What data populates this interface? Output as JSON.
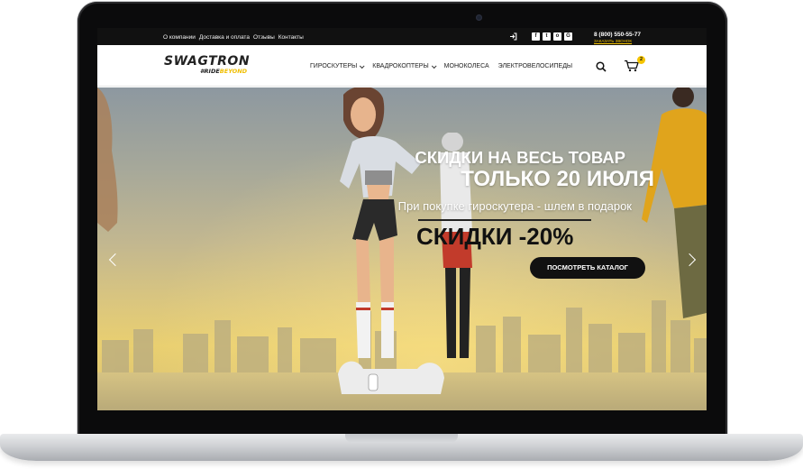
{
  "topbar": {
    "links": [
      "О компании",
      "Доставка и оплата",
      "Отзывы",
      "Контакты"
    ],
    "socials": [
      "f",
      "t",
      "o",
      "G"
    ],
    "phone": "8 (800) 550-55-77",
    "callback": "ЗАКАЗАТЬ ЗВОНОК"
  },
  "header": {
    "logo_main": "SWAGTRON",
    "logo_sub_hash": "#RIDE",
    "logo_sub_accent": "BEYOND",
    "nav": [
      {
        "label": "ГИРОСКУТЕРЫ",
        "dropdown": true
      },
      {
        "label": "КВАДРОКОПТЕРЫ",
        "dropdown": true
      },
      {
        "label": "МОНОКОЛЕСА",
        "dropdown": false
      },
      {
        "label": "ЭЛЕКТРОВЕЛОСИПЕДЫ",
        "dropdown": false
      }
    ],
    "cart_count": "2"
  },
  "hero": {
    "title_line1": "СКИДКИ НА ВЕСЬ ТОВАР",
    "title_line2": "ТОЛЬКО 20 ИЮЛЯ",
    "subtitle": "При покупке гироскутера - шлем в подарок",
    "discount": "СКИДКИ -20%",
    "button_label": "ПОСМОТРЕТЬ КАТАЛОГ"
  },
  "colors": {
    "accent": "#f5c400",
    "topbar": "#111111",
    "button": "#111111"
  },
  "icons": {
    "login": "login-icon",
    "search": "search-icon",
    "cart": "cart-icon",
    "prev": "chevron-left-icon",
    "next": "chevron-right-icon"
  }
}
